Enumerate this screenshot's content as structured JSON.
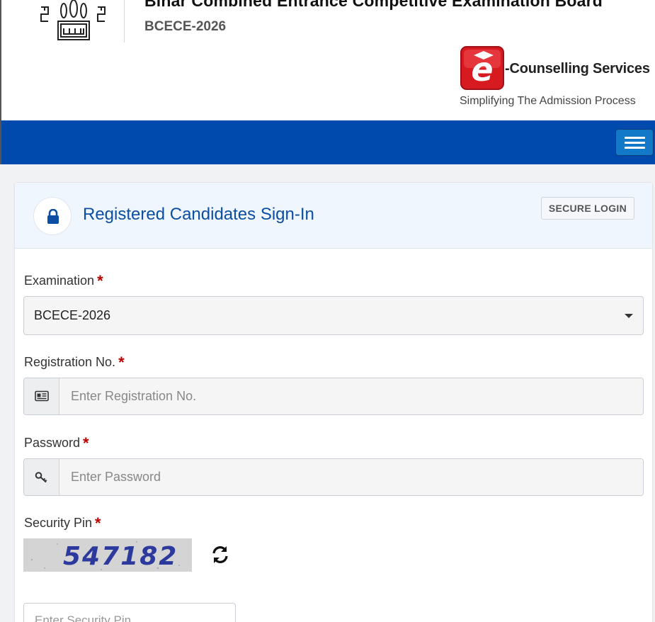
{
  "header": {
    "board_title": "Bihar Combined Entrance Competitive Examination Board",
    "exam_subtitle": "BCECE-2026",
    "brand_name": "-Counselling Services",
    "brand_tagline": "Simplifying The Admission Process",
    "logo_icon": "emblem-logo",
    "brand_icon": "e-counselling-logo"
  },
  "navbar": {
    "menu_icon": "hamburger-menu-icon",
    "color": "#004aad"
  },
  "login_card": {
    "title": "Registered Candidates Sign-In",
    "badge": "SECURE LOGIN",
    "lock_icon": "lock-icon",
    "fields": {
      "examination": {
        "label": "Examination",
        "required_mark": "*",
        "selected_value": "BCECE-2026"
      },
      "registration": {
        "label": "Registration No.",
        "required_mark": "*",
        "placeholder": "Enter Registration No.",
        "value": "",
        "icon": "id-card-icon"
      },
      "password": {
        "label": "Password",
        "required_mark": "*",
        "placeholder": "Enter Password",
        "value": "",
        "icon": "key-icon"
      },
      "security_pin": {
        "label": "Security Pin",
        "required_mark": "*",
        "captcha_text": "547182",
        "refresh_icon": "refresh-icon",
        "placeholder": "Enter Security Pin",
        "value": ""
      }
    }
  },
  "colors": {
    "primary": "#004aad",
    "title_blue": "#0b4ea2",
    "required": "#bb0000",
    "brand_red": "#d71920"
  }
}
